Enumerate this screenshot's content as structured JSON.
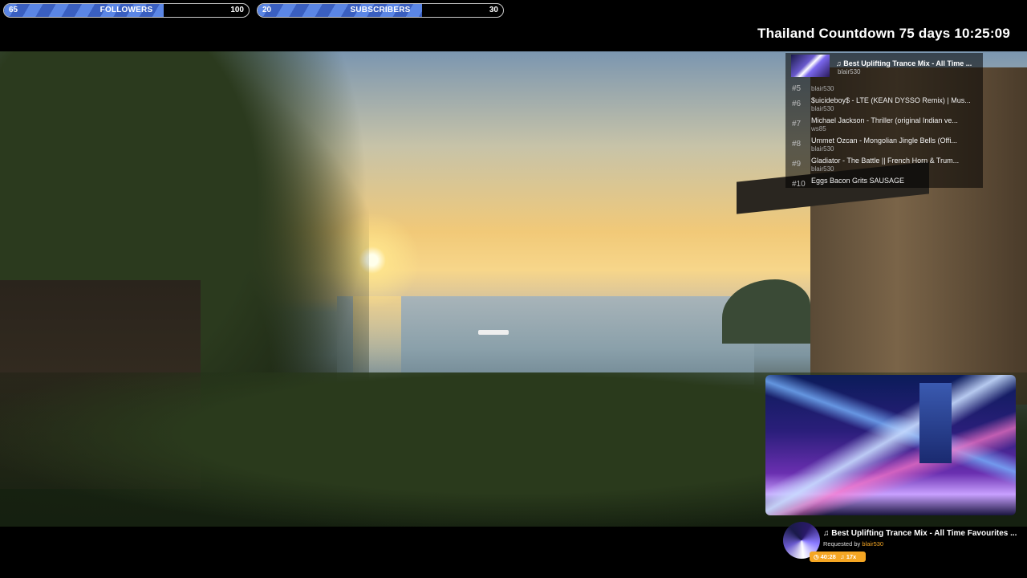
{
  "goals": {
    "followers": {
      "start": "65",
      "label": "FOLLOWERS",
      "target": "100",
      "progress": 0.65
    },
    "subscribers": {
      "start": "20",
      "label": "SUBSCRIBERS",
      "target": "30",
      "progress": 0.67
    }
  },
  "countdown": {
    "text": "Thailand Countdown 75 days 10:25:09"
  },
  "playlist": {
    "now": {
      "title": "♫ Best Uplifting Trance Mix - All Time ...",
      "user": "blair530"
    },
    "items": [
      {
        "num": "#5",
        "title": "",
        "user": "blair530"
      },
      {
        "num": "#6",
        "title": "$uicideboy$ - LTE (KEAN DYSSO Remix) | Mus...",
        "user": "blair530"
      },
      {
        "num": "#7",
        "title": "Michael Jackson - Thriller (original Indian ve...",
        "user": "ws85"
      },
      {
        "num": "#8",
        "title": "Ummet Ozcan - Mongolian Jingle Bells (Offi...",
        "user": "blair530"
      },
      {
        "num": "#9",
        "title": "Gladiator - The Battle || French Horn & Trum...",
        "user": "blair530"
      },
      {
        "num": "#10",
        "title": "Eggs Bacon Grits SAUSAGE",
        "user": ""
      }
    ]
  },
  "now_playing": {
    "title": "♫ Best Uplifting Trance Mix - All Time Favourites ...",
    "requested_prefix": "Requested by",
    "requested_user": "blair530",
    "time": "40:28",
    "queue": "♫ 17x"
  }
}
